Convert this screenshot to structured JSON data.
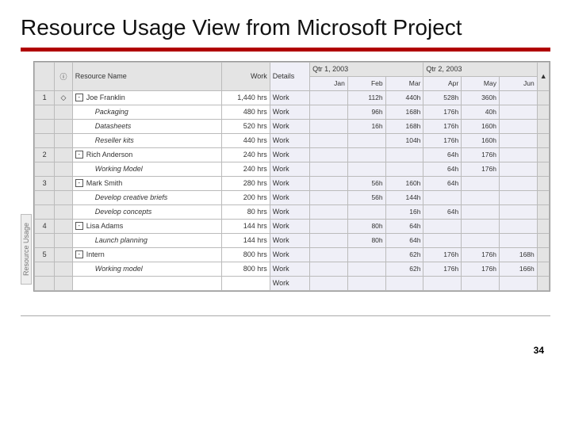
{
  "slide": {
    "title": "Resource Usage View from Microsoft Project",
    "page_number": "34"
  },
  "app": {
    "sidebar_label": "Resource Usage"
  },
  "headers": {
    "info_icon": "ⓘ",
    "resource_name": "Resource Name",
    "work": "Work",
    "details": "Details",
    "qtr1": "Qtr 1, 2003",
    "qtr2": "Qtr 2, 2003",
    "months": [
      "Jan",
      "Feb",
      "Mar",
      "Apr",
      "May",
      "Jun"
    ],
    "expand_glyph": "⊟",
    "scroll_up": "▲"
  },
  "rows": [
    {
      "id": "1",
      "info": "◇",
      "name": "Joe Franklin",
      "kind": "res",
      "work": "1,440 hrs",
      "det": "Work",
      "m": [
        "",
        "112h",
        "440h",
        "528h",
        "360h",
        ""
      ]
    },
    {
      "id": "",
      "info": "",
      "name": "Packaging",
      "kind": "task",
      "work": "480 hrs",
      "det": "Work",
      "m": [
        "",
        "96h",
        "168h",
        "176h",
        "40h",
        ""
      ]
    },
    {
      "id": "",
      "info": "",
      "name": "Datasheets",
      "kind": "task",
      "work": "520 hrs",
      "det": "Work",
      "m": [
        "",
        "16h",
        "168h",
        "176h",
        "160h",
        ""
      ]
    },
    {
      "id": "",
      "info": "",
      "name": "Reseller kits",
      "kind": "task",
      "work": "440 hrs",
      "det": "Work",
      "m": [
        "",
        "",
        "104h",
        "176h",
        "160h",
        ""
      ]
    },
    {
      "id": "2",
      "info": "",
      "name": "Rich Anderson",
      "kind": "res",
      "work": "240 hrs",
      "det": "Work",
      "m": [
        "",
        "",
        "",
        "64h",
        "176h",
        ""
      ]
    },
    {
      "id": "",
      "info": "",
      "name": "Working Model",
      "kind": "task",
      "work": "240 hrs",
      "det": "Work",
      "m": [
        "",
        "",
        "",
        "64h",
        "176h",
        ""
      ]
    },
    {
      "id": "3",
      "info": "",
      "name": "Mark Smith",
      "kind": "res",
      "work": "280 hrs",
      "det": "Work",
      "m": [
        "",
        "56h",
        "160h",
        "64h",
        "",
        ""
      ]
    },
    {
      "id": "",
      "info": "",
      "name": "Develop creative briefs",
      "kind": "task",
      "work": "200 hrs",
      "det": "Work",
      "m": [
        "",
        "56h",
        "144h",
        "",
        "",
        ""
      ]
    },
    {
      "id": "",
      "info": "",
      "name": "Develop concepts",
      "kind": "task",
      "work": "80 hrs",
      "det": "Work",
      "m": [
        "",
        "",
        "16h",
        "64h",
        "",
        ""
      ]
    },
    {
      "id": "4",
      "info": "",
      "name": "Lisa Adams",
      "kind": "res",
      "work": "144 hrs",
      "det": "Work",
      "m": [
        "",
        "80h",
        "64h",
        "",
        "",
        ""
      ]
    },
    {
      "id": "",
      "info": "",
      "name": "Launch planning",
      "kind": "task",
      "work": "144 hrs",
      "det": "Work",
      "m": [
        "",
        "80h",
        "64h",
        "",
        "",
        ""
      ]
    },
    {
      "id": "5",
      "info": "",
      "name": "Intern",
      "kind": "res",
      "work": "800 hrs",
      "det": "Work",
      "m": [
        "",
        "",
        "62h",
        "176h",
        "176h",
        "168h"
      ]
    },
    {
      "id": "",
      "info": "",
      "name": "Working model",
      "kind": "task",
      "work": "800 hrs",
      "det": "Work",
      "m": [
        "",
        "",
        "62h",
        "176h",
        "176h",
        "166h"
      ]
    },
    {
      "id": "",
      "info": "",
      "name": "",
      "kind": "blank",
      "work": "",
      "det": "Work",
      "m": [
        "",
        "",
        "",
        "",
        "",
        ""
      ]
    }
  ]
}
